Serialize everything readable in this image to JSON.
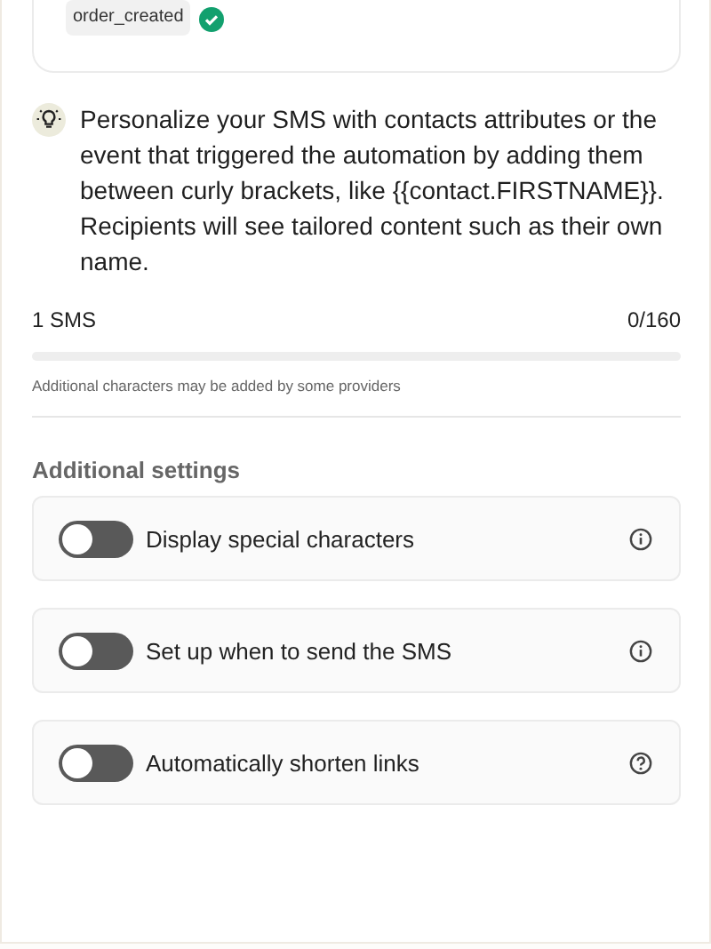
{
  "event_card": {
    "tag": "order_created",
    "verified": true
  },
  "tip": {
    "text": "Personalize your SMS with contacts attributes or the event that triggered the automation by adding them between curly brackets, like {{contact.FIRSTNAME}}. Recipients will see tailored content such as their own name."
  },
  "counter": {
    "sms_count": "1 SMS",
    "characters": "0/160",
    "level": 0,
    "note": "Additional characters may be added by some providers"
  },
  "additional_settings": {
    "title": "Additional settings",
    "items": [
      {
        "label": "Display special characters",
        "on": false,
        "kind": "info"
      },
      {
        "label": "Set up when to send the SMS",
        "on": false,
        "kind": "info"
      },
      {
        "label": "Automatically shorten links",
        "on": false,
        "kind": "help"
      }
    ]
  }
}
